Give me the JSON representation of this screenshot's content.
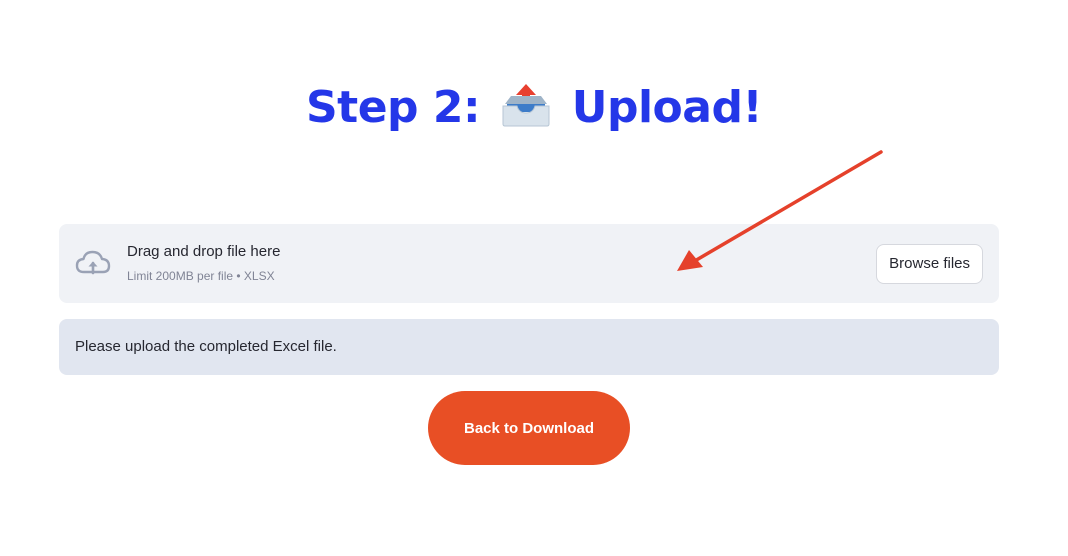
{
  "title": {
    "prefix": "Step 2: ",
    "suffix": " Upload!",
    "icon": "outbox-tray-icon",
    "color": "#2437e8"
  },
  "uploader": {
    "main_text": "Drag and drop file here",
    "sub_text": "Limit 200MB per file • XLSX",
    "browse_label": "Browse files",
    "icon": "cloud-upload-icon"
  },
  "info": {
    "message": "Please upload the completed Excel file."
  },
  "back_button": {
    "label": "Back to Download",
    "color": "#e84f25"
  },
  "annotation": {
    "icon": "red-arrow-icon",
    "color": "#e5412b"
  }
}
